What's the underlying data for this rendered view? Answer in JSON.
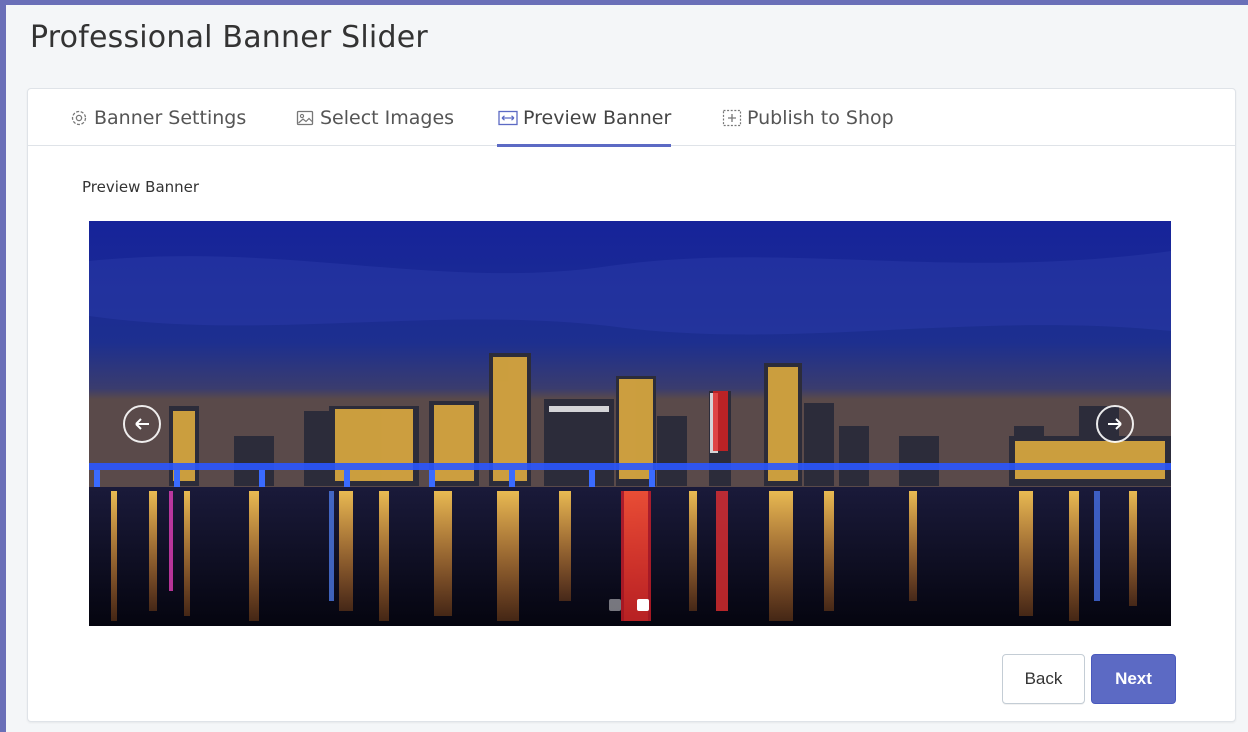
{
  "app": {
    "title": "Professional Banner Slider"
  },
  "tabs": [
    {
      "label": "Banner Settings",
      "icon": "gear-icon",
      "active": false
    },
    {
      "label": "Select Images",
      "icon": "image-icon",
      "active": false
    },
    {
      "label": "Preview Banner",
      "icon": "preview-icon",
      "active": true
    },
    {
      "label": "Publish to Shop",
      "icon": "publish-icon",
      "active": false
    }
  ],
  "preview": {
    "label": "Preview Banner",
    "slide_count": 2,
    "active_slide": 2,
    "prev_icon": "arrow-left-icon",
    "next_icon": "arrow-right-icon"
  },
  "actions": {
    "back_label": "Back",
    "next_label": "Next"
  },
  "colors": {
    "accent": "#5c6ac4",
    "frame": "#6a6fb8",
    "tab_underline": "#5c6ac4"
  }
}
